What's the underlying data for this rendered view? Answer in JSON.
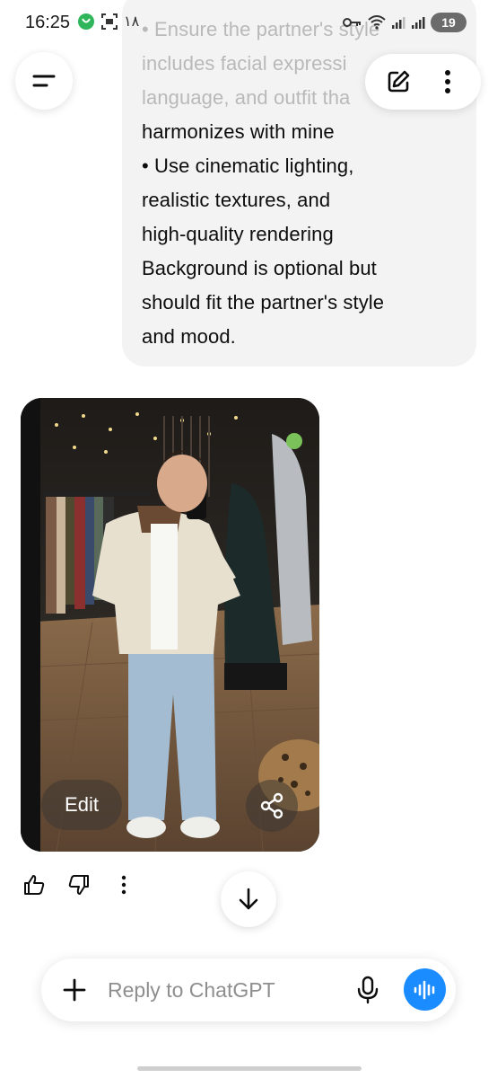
{
  "status_bar": {
    "time": "16:25",
    "notification_text": "١٨",
    "battery": "19",
    "icons": [
      "vpn-icon",
      "screenshot-icon",
      "key-icon",
      "wifi-icon",
      "signal-icon",
      "signal-icon",
      "battery-icon"
    ]
  },
  "conversation": {
    "user_message": {
      "faded_lines": [
        "• Ensure the partner's style",
        "includes facial expressi",
        "language, and outfit tha"
      ],
      "lines": [
        "harmonizes with mine",
        "• Use cinematic lighting,",
        "realistic textures, and",
        "high-quality rendering",
        "Background is optional but",
        "should fit the partner's style",
        "and mood."
      ]
    },
    "assistant_image": {
      "edit_label": "Edit",
      "share_icon": "share-icon"
    },
    "feedback_icons": [
      "thumbs-up-icon",
      "thumbs-down-icon",
      "more-vertical-icon"
    ]
  },
  "header": {
    "menu_icon": "menu-icon",
    "new_chat_icon": "edit-icon",
    "more_icon": "more-vertical-icon"
  },
  "composer": {
    "placeholder": "Reply to ChatGPT",
    "value": "",
    "accent_color": "#1a8cff"
  }
}
